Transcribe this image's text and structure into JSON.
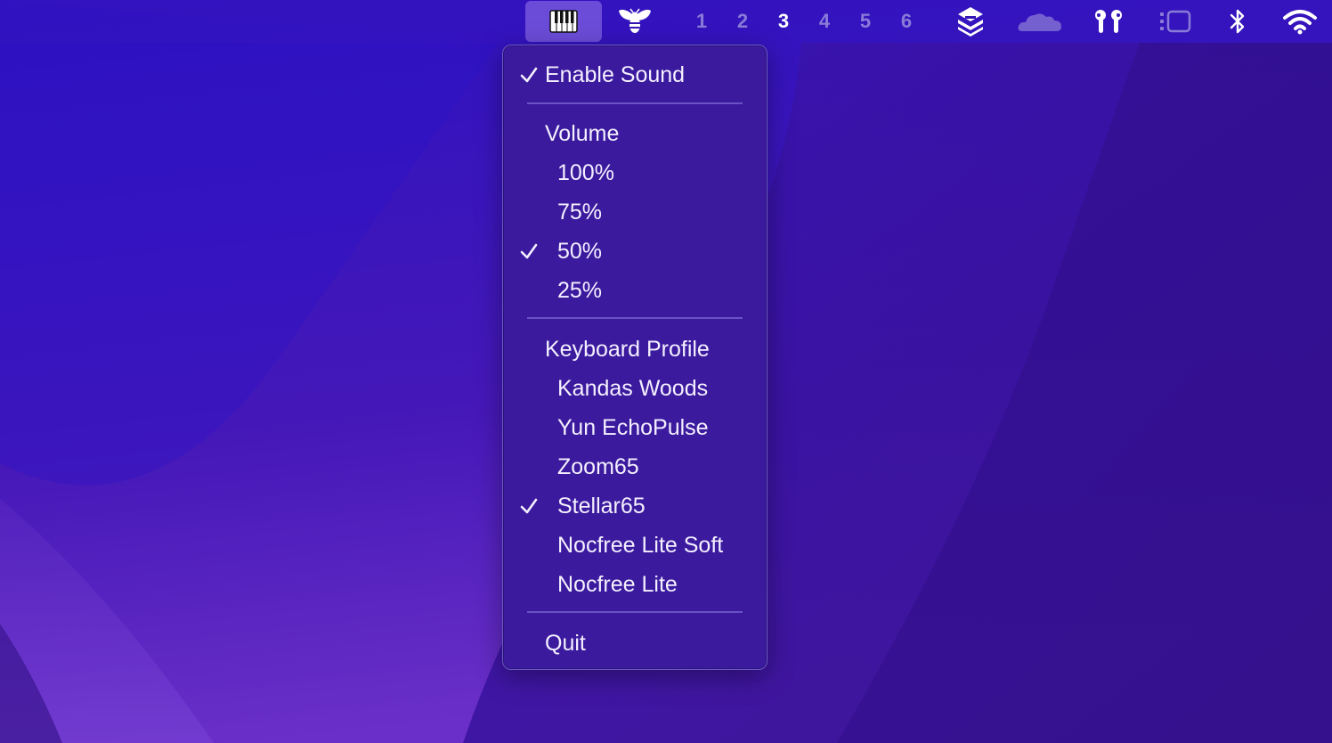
{
  "menubar": {
    "spaces": [
      "1",
      "2",
      "3",
      "4",
      "5",
      "6"
    ],
    "active_space": "3",
    "icons": [
      "piano-keys-icon",
      "bee-icon",
      "stack-layers-icon",
      "cloudflare-cloud-icon",
      "airpods-icon",
      "stage-manager-icon",
      "bluetooth-icon",
      "wifi-icon"
    ]
  },
  "menu": {
    "enable_sound": {
      "label": "Enable Sound",
      "checked": true
    },
    "volume": {
      "header": "Volume",
      "options": [
        {
          "label": "100%",
          "checked": false
        },
        {
          "label": "75%",
          "checked": false
        },
        {
          "label": "50%",
          "checked": true
        },
        {
          "label": "25%",
          "checked": false
        }
      ]
    },
    "keyboard_profile": {
      "header": "Keyboard Profile",
      "options": [
        {
          "label": "Kandas Woods",
          "checked": false
        },
        {
          "label": "Yun EchoPulse",
          "checked": false
        },
        {
          "label": "Zoom65",
          "checked": false
        },
        {
          "label": "Stellar65",
          "checked": true
        },
        {
          "label": "Nocfree Lite Soft",
          "checked": false
        },
        {
          "label": "Nocfree Lite",
          "checked": false
        }
      ]
    },
    "quit": "Quit"
  },
  "colors": {
    "wallpaper_dark": "#2b0fa8",
    "wallpaper_light": "#7a3fd0",
    "menu_bg": "#3b1a9e",
    "highlight": "#6b4cd8"
  }
}
